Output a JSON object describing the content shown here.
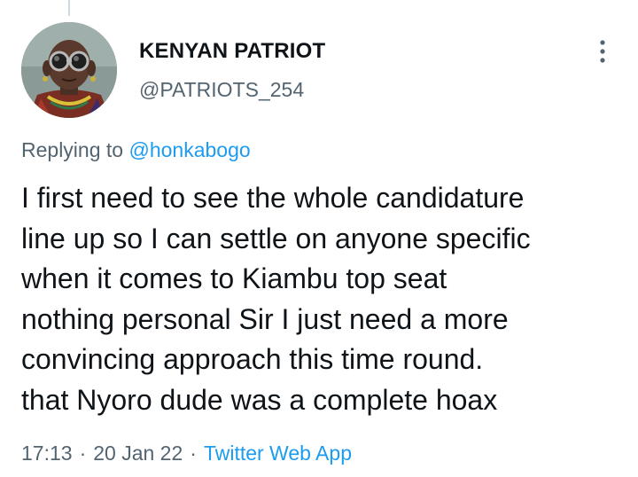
{
  "author": {
    "name": "KENYAN PATRIOT",
    "handle": "@PATRIOTS_254"
  },
  "reply": {
    "prefix": "Replying to",
    "mention": "@honkabogo"
  },
  "body_lines": [
    "I first need to see the whole candidature",
    "line up so I can settle on anyone specific",
    "when it comes to Kiambu top seat",
    "nothing personal Sir I just need a more",
    "convincing approach this time round.",
    "that Nyoro dude was a complete hoax"
  ],
  "meta": {
    "time": "17:13",
    "separator": "·",
    "date": "20 Jan 22",
    "source": "Twitter Web App"
  },
  "icons": {
    "more": "more-vertical-icon"
  },
  "colors": {
    "text_primary": "#0f1419",
    "text_secondary": "#536471",
    "accent": "#1d9bf0",
    "thread_line": "#cfd9de"
  }
}
